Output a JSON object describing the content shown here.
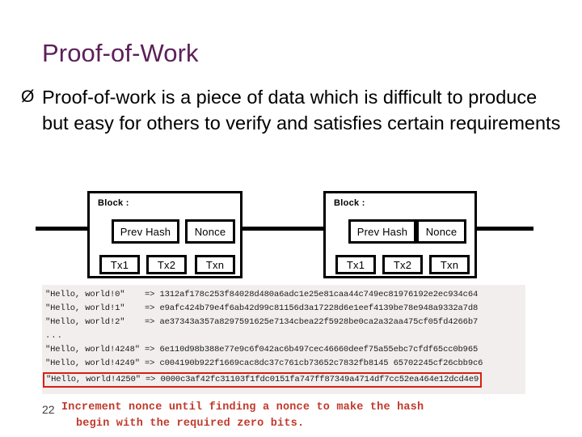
{
  "slide": {
    "title": "Proof-of-Work",
    "page_number": "22",
    "bullet_marker": "Ø",
    "bullet_text": "Proof-of-work is a piece of data which is difficult to produce but easy for others to verify and satisfies certain requirements",
    "title_color": "#5c2059",
    "caption_color": "#c0392b",
    "highlight_color": "#d81f12"
  },
  "diagram": {
    "blocks": [
      {
        "label": "Block :",
        "prev_hash": "Prev Hash",
        "nonce": "Nonce",
        "transactions": [
          "Tx1",
          "Tx2",
          "Txn"
        ]
      },
      {
        "label": "Block :",
        "prev_hash": "Prev Hash",
        "nonce": "Nonce",
        "transactions": [
          "Tx1",
          "Tx2",
          "Txn"
        ]
      }
    ]
  },
  "console": {
    "lines": [
      "\"Hello, world!0\"    => 1312af178c253f84028d480a6adc1e25e81caa44c749ec81976192e2ec934c64",
      "\"Hello, world!1\"    => e9afc424b79e4f6ab42d99c81156d3a17228d6e1eef4139be78e948a9332a7d8",
      "\"Hello, world!2\"    => ae37343a357a8297591625e7134cbea22f5928be0ca2a32aa475cf05fd4266b7",
      "...",
      "\"Hello, world!4248\" => 6e110d98b388e77e9c6f042ac6b497cec46660deef75a55ebc7cfdf65cc0b965",
      "\"Hello, world!4249\" => c004190b922f1669cac8dc37c761cb73652c7832fb8145 65702245cf26cbb9c6"
    ],
    "highlighted_line": "\"Hello, world!4250\" => 0000c3af42fc31103f1fdc0151fa747ff87349a4714df7cc52ea464e12dcd4e9"
  },
  "caption": {
    "line1": "Increment nonce until finding a nonce to make the hash",
    "line2": "begin with the required zero bits."
  }
}
